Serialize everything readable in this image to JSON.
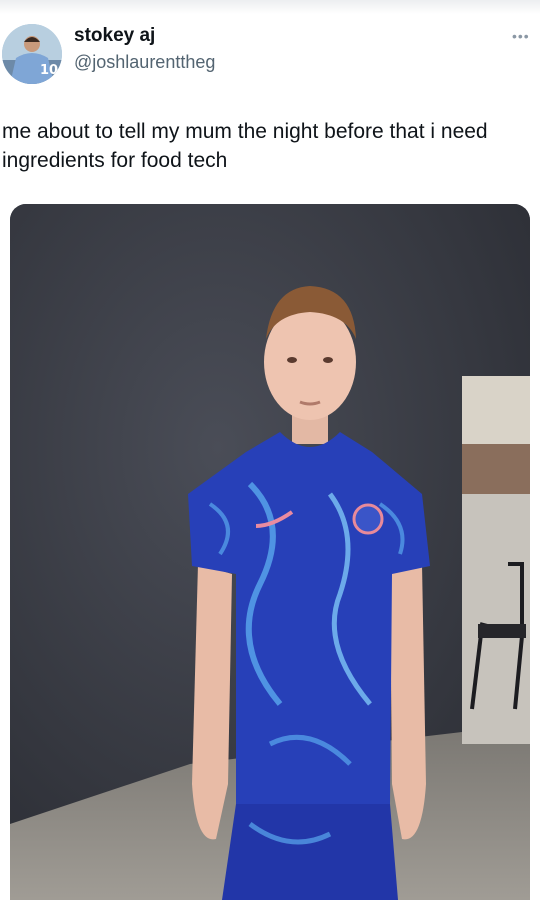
{
  "tweet": {
    "author": {
      "display_name": "stokey aj",
      "handle": "@joshlaurenttheg",
      "avatar_jersey_number": "10"
    },
    "more_icon": "more-dots-icon",
    "text": "me about to tell my mum the night before that i need ingredients for food tech",
    "media": {
      "kind": "photo",
      "subject": "footballer-in-blue-kit",
      "colors": {
        "backdrop": "#3b3e47",
        "kit": "#2740b8",
        "kit_swirl": "#5aa8ee",
        "floor": "#8f8b85"
      }
    }
  }
}
